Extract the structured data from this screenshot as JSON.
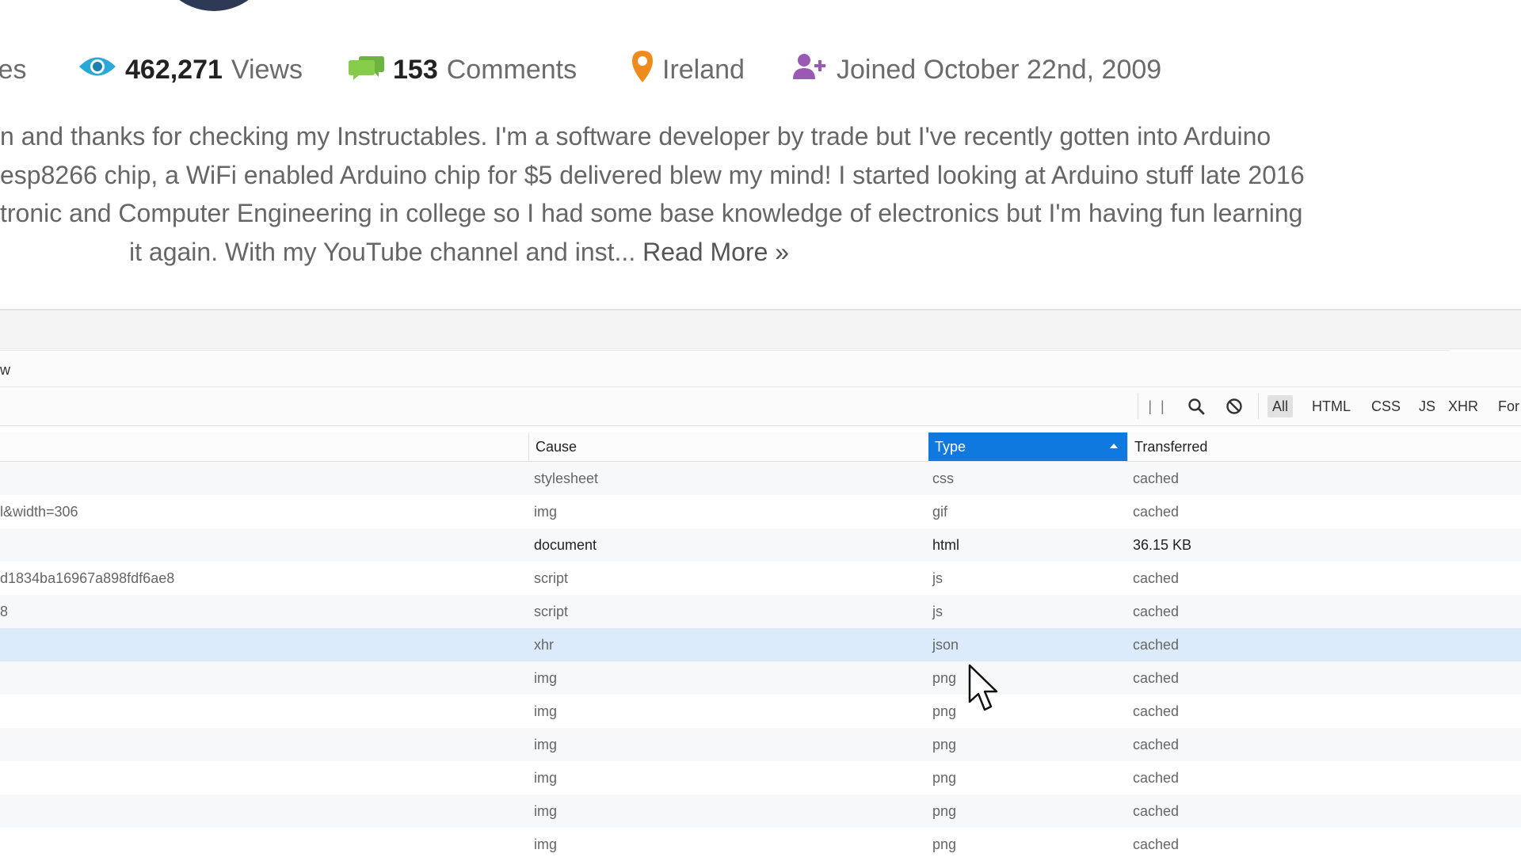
{
  "profile": {
    "stats": {
      "articles_tail": "les",
      "views_count": "462,271",
      "views_label": "Views",
      "comments_count": "153",
      "comments_label": "Comments",
      "location": "Ireland",
      "joined": "Joined October 22nd, 2009"
    },
    "bio": {
      "line1": "n and thanks for checking my Instructables. I'm a software developer by trade but I've recently gotten into Arduino",
      "line2": "esp8266 chip, a WiFi enabled Arduino chip for $5 delivered blew my mind! I started looking at Arduino stuff late 2016",
      "line3": "tronic and Computer Engineering in college so I had some base knowledge of electronics but I'm having fun learning",
      "line4": "it again. With my YouTube channel and inst...",
      "read_more": "Read More »"
    },
    "colors": {
      "views_icon": "#2aa8d8",
      "comments_icon": "#7cc242",
      "location_icon": "#f08a1c",
      "joined_icon": "#9b59b6"
    }
  },
  "devtools": {
    "tab_label": "w",
    "toolbar": {
      "pause": "| |",
      "filters": [
        "All",
        "HTML",
        "CSS",
        "JS",
        "XHR",
        "For"
      ],
      "active_filter": "All"
    },
    "columns": {
      "cause": "Cause",
      "type": "Type",
      "transferred": "Transferred"
    },
    "rows": [
      {
        "file": "",
        "cause": "stylesheet",
        "type": "css",
        "transferred": "cached"
      },
      {
        "file": "l&width=306",
        "cause": "img",
        "type": "gif",
        "transferred": "cached"
      },
      {
        "file": "",
        "cause": "document",
        "type": "html",
        "transferred": "36.15 KB"
      },
      {
        "file": "d1834ba16967a898fdf6ae8",
        "cause": "script",
        "type": "js",
        "transferred": "cached"
      },
      {
        "file": "8",
        "cause": "script",
        "type": "js",
        "transferred": "cached"
      },
      {
        "file": "",
        "cause": "xhr",
        "type": "json",
        "transferred": "cached"
      },
      {
        "file": "",
        "cause": "img",
        "type": "png",
        "transferred": "cached"
      },
      {
        "file": "",
        "cause": "img",
        "type": "png",
        "transferred": "cached"
      },
      {
        "file": "",
        "cause": "img",
        "type": "png",
        "transferred": "cached"
      },
      {
        "file": "",
        "cause": "img",
        "type": "png",
        "transferred": "cached"
      },
      {
        "file": "",
        "cause": "img",
        "type": "png",
        "transferred": "cached"
      },
      {
        "file": "",
        "cause": "img",
        "type": "png",
        "transferred": "cached"
      }
    ],
    "selected_row": 5,
    "accent": "#0f79e0"
  }
}
